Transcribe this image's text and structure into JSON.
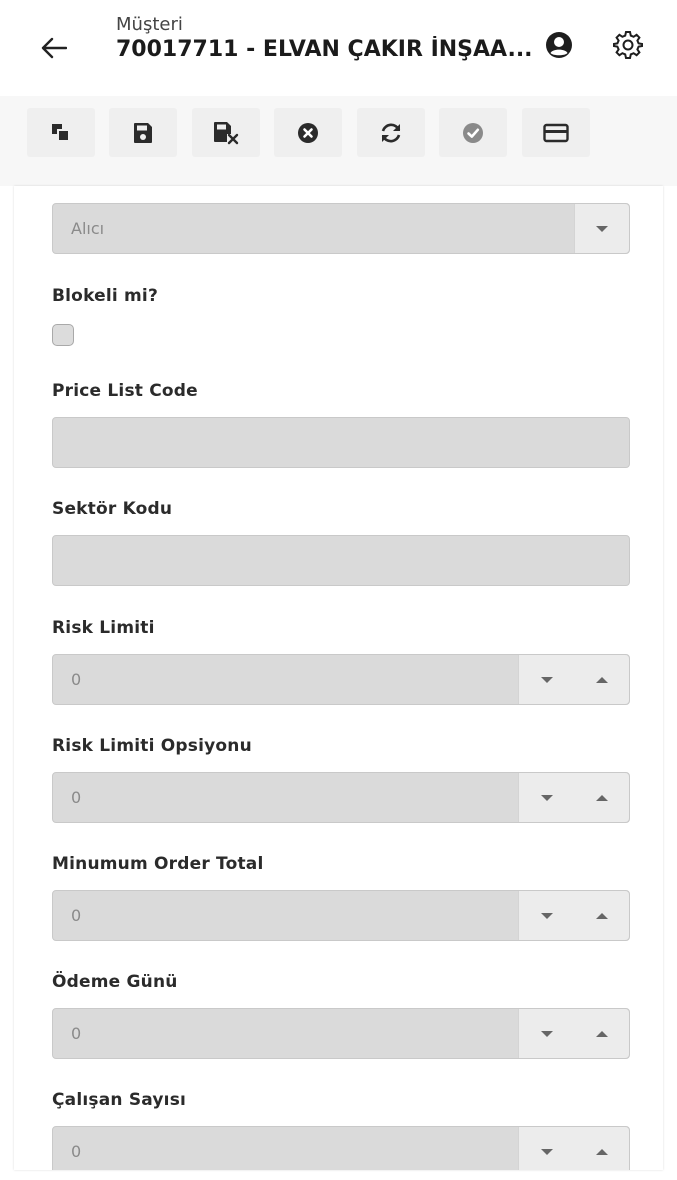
{
  "header": {
    "subtitle": "Müşteri",
    "title": "70017711 - ELVAN ÇAKIR İNŞAA..."
  },
  "toolbar": {
    "buttons": [
      {
        "icon": "copy-icon"
      },
      {
        "icon": "save-icon"
      },
      {
        "icon": "save-close-icon"
      },
      {
        "icon": "cancel-icon"
      },
      {
        "icon": "refresh-icon"
      },
      {
        "icon": "check-icon"
      },
      {
        "icon": "card-icon"
      }
    ]
  },
  "form": {
    "role_select": {
      "value": "Alıcı"
    },
    "blocked": {
      "label": "Blokeli mi?",
      "checked": false
    },
    "price_list_code": {
      "label": "Price List Code",
      "value": ""
    },
    "sector_code": {
      "label": "Sektör Kodu",
      "value": ""
    },
    "risk_limit": {
      "label": "Risk Limiti",
      "value": "0"
    },
    "risk_limit_option": {
      "label": "Risk Limiti Opsiyonu",
      "value": "0"
    },
    "min_order_total": {
      "label": "Minumum Order Total",
      "value": "0"
    },
    "payment_day": {
      "label": "Ödeme Günü",
      "value": "0"
    },
    "employee_count": {
      "label": "Çalışan Sayısı",
      "value": "0"
    }
  },
  "colors": {
    "field_bg": "#dadada",
    "toolbar_bg": "#f7f7f7",
    "icon": "#2b2b2b"
  }
}
